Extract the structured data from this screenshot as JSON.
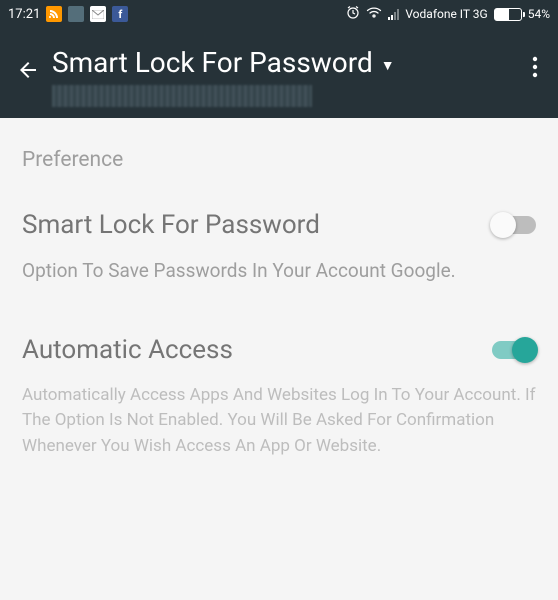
{
  "status": {
    "time": "17:21",
    "carrier": "Vodafone IT 3G",
    "battery_pct": "54%",
    "battery_fill_width": "54%"
  },
  "header": {
    "title": "Smart Lock For Password"
  },
  "content": {
    "section_label": "Preference",
    "setting1": {
      "title": "Smart Lock For Password",
      "desc": "Option To Save Passwords In Your Account Google."
    },
    "setting2": {
      "title": "Automatic Access",
      "desc": "Automatically Access Apps And Websites Log In To Your Account. If The Option Is Not Enabled. You Will Be Asked For Confirmation Whenever You Wish Access An App Or Website."
    }
  }
}
